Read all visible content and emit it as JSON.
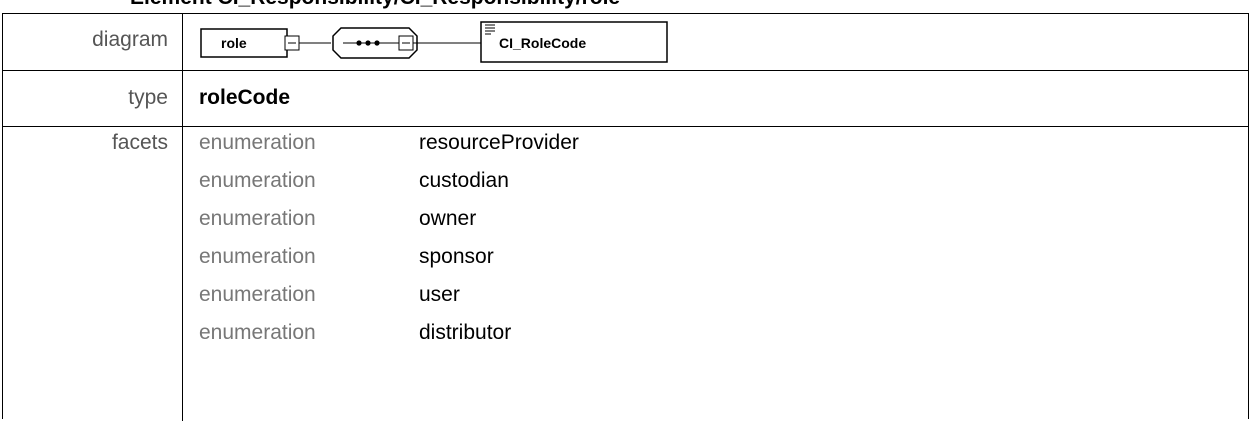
{
  "heading": "Element CI_Responsibility/CI_Responsibility/role",
  "diagram": {
    "label": "diagram",
    "element_name": "role",
    "type_name": "CI_RoleCode"
  },
  "type_row": {
    "label": "type",
    "value": "roleCode"
  },
  "facets_row": {
    "label": "facets",
    "items": [
      {
        "kind": "enumeration",
        "value": "resourceProvider"
      },
      {
        "kind": "enumeration",
        "value": "custodian"
      },
      {
        "kind": "enumeration",
        "value": "owner"
      },
      {
        "kind": "enumeration",
        "value": "sponsor"
      },
      {
        "kind": "enumeration",
        "value": "user"
      },
      {
        "kind": "enumeration",
        "value": "distributor"
      }
    ]
  }
}
